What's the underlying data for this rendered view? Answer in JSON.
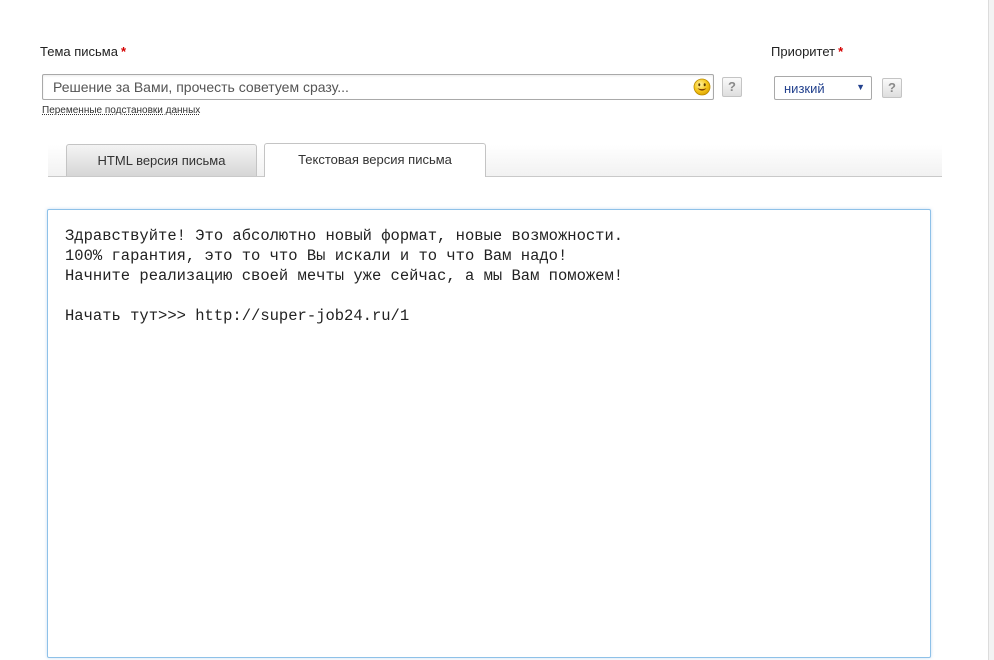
{
  "subject": {
    "label": "Тема письма",
    "required_mark": "*",
    "value": "Решение за Вами, прочесть советуем сразу...",
    "emoji_icon": "smiley-face-icon",
    "help_label": "?",
    "variables_link": "Переменные подстановки данных"
  },
  "priority": {
    "label": "Приоритет",
    "required_mark": "*",
    "selected": "низкий",
    "arrow": "▼",
    "help_label": "?"
  },
  "tabs": [
    {
      "label": "HTML версия письма",
      "active": false
    },
    {
      "label": "Текстовая версия письма",
      "active": true
    }
  ],
  "body": {
    "text": "Здравствуйте! Это абсолютно новый формат, новые возможности.\n100% гарантия, это то что Вы искали и то что Вам надо!\nНачните реализацию своей мечты уже сейчас, а мы Вам поможем!\n\nНачать тут>>> http://super-job24.ru/1"
  },
  "colors": {
    "required": "#d40000",
    "select_text": "#24428e",
    "focus_border": "#8ec1e8"
  }
}
